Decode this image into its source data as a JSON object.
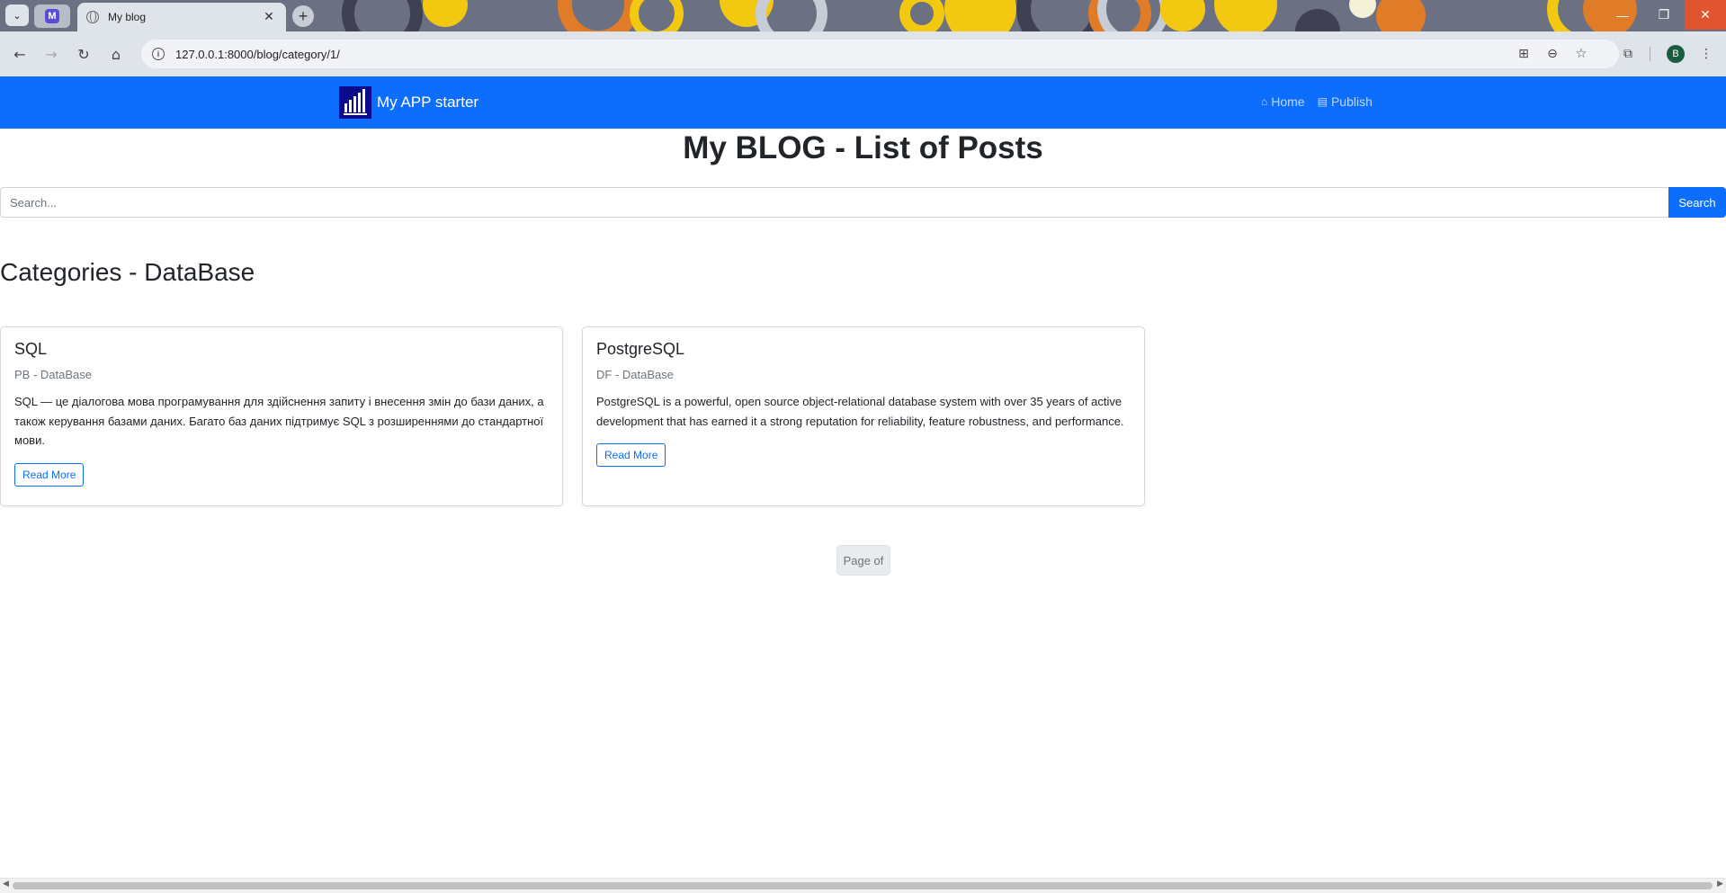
{
  "browser": {
    "tab_title": "My blog",
    "pinned_tab_letter": "M",
    "url": "127.0.0.1:8000/blog/category/1/",
    "profile_initial": "B",
    "tab_close": "✕",
    "new_tab": "+"
  },
  "navbar": {
    "brand_name": "My APP starter",
    "links": [
      {
        "label": "Home",
        "icon": "home-icon"
      },
      {
        "label": "Publish",
        "icon": "book-icon"
      }
    ]
  },
  "page": {
    "title": "My BLOG - List of Posts",
    "search_placeholder": "Search...",
    "search_button": "Search",
    "section_heading": "Categories - DataBase"
  },
  "posts": [
    {
      "title": "SQL",
      "subtitle": "PB - DataBase",
      "text": "SQL — це діалогова мова програмування для здійснення запиту і внесення змін до бази даних, а також керування базами даних. Багато баз даних підтримує SQL з розширеннями до стандартної мови.",
      "button": "Read More"
    },
    {
      "title": "PostgreSQL",
      "subtitle": "DF - DataBase",
      "text": "PostgreSQL is a powerful, open source object-relational database system with over 35 years of active development that has earned it a strong reputation for reliability, feature robustness, and performance.",
      "button": "Read More"
    }
  ],
  "pagination": {
    "label": "Page of"
  },
  "colors": {
    "primary": "#0d6efd",
    "text": "#212529",
    "muted": "#6c757d"
  }
}
